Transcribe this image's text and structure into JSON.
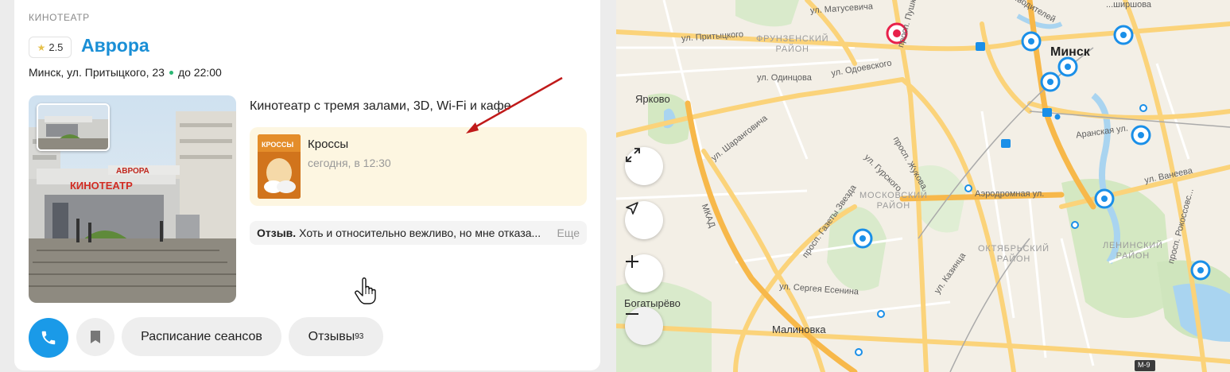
{
  "card": {
    "category": "КИНОТЕАТР",
    "rating": "2.5",
    "title": "Аврора",
    "address": "Минск, ул. Притыцкого, 23",
    "hours": "до 22:00",
    "description": "Кинотеатр с тремя залами, 3D, Wi-Fi и кафе",
    "event": {
      "name": "Кроссы",
      "time": "сегодня, в 12:30",
      "poster_text": "КРОССЫ"
    },
    "review": {
      "label": "Отзыв.",
      "text": "Хоть и относительно вежливо, но мне отказа...",
      "more": "Еще"
    },
    "photo_sign": "КИНОТЕАТР",
    "photo_sign_top": "АВРОРА"
  },
  "actions": {
    "schedule": "Расписание сеансов",
    "reviews": "Отзывы",
    "reviews_count": "93"
  },
  "map": {
    "city": "Минск",
    "districts": {
      "frunzensky": [
        "ФРУНЗЕНСКИЙ",
        "РАЙОН"
      ],
      "moskovsky": [
        "МОСКОВСКИЙ",
        "РАЙОН"
      ],
      "oktyabrsky": [
        "ОКТЯБРЬСКИЙ",
        "РАЙОН"
      ],
      "leninsky": [
        "ЛЕНИНСКИЙ",
        "РАЙОН"
      ]
    },
    "streets": {
      "matusevicha": "ул. Матусевича",
      "pushkina": "просп. Пушк...",
      "pritytskogo": "ул. Притыцкого",
      "odintsova": "ул. Одинцова",
      "odoevskogo": "ул. Одоевского",
      "sharangovicha": "ул. Шаранговича",
      "zhukova": "просп. Жукова",
      "gurskogo": "ул. Гурского",
      "gazety_zvezda": "просп. Газеты Звезда",
      "kazintsa": "ул. Казинца",
      "esenina": "ул. Сергея Есенина",
      "aerodromnaya": "Аэродромная ул.",
      "aranskaya": "Аранская ул.",
      "vaneeva": "ул. Ванеева",
      "rokossovskogo": "просп. Рокоссовс...",
      "mkad": "МКАД",
      "shirshova": "...ширшова",
      "voditeley": "...водителей",
      "m9": "М-9"
    },
    "places": {
      "yarkovo": "Ярково",
      "bogatyrevo": "Богатырёво",
      "malinovka": "Малиновка"
    },
    "colors": {
      "selected": "#e8214a",
      "poi": "#1a8fe8",
      "road": "#fbd37a",
      "water": "#a9d4f0",
      "park": "#d4e8c2"
    }
  }
}
